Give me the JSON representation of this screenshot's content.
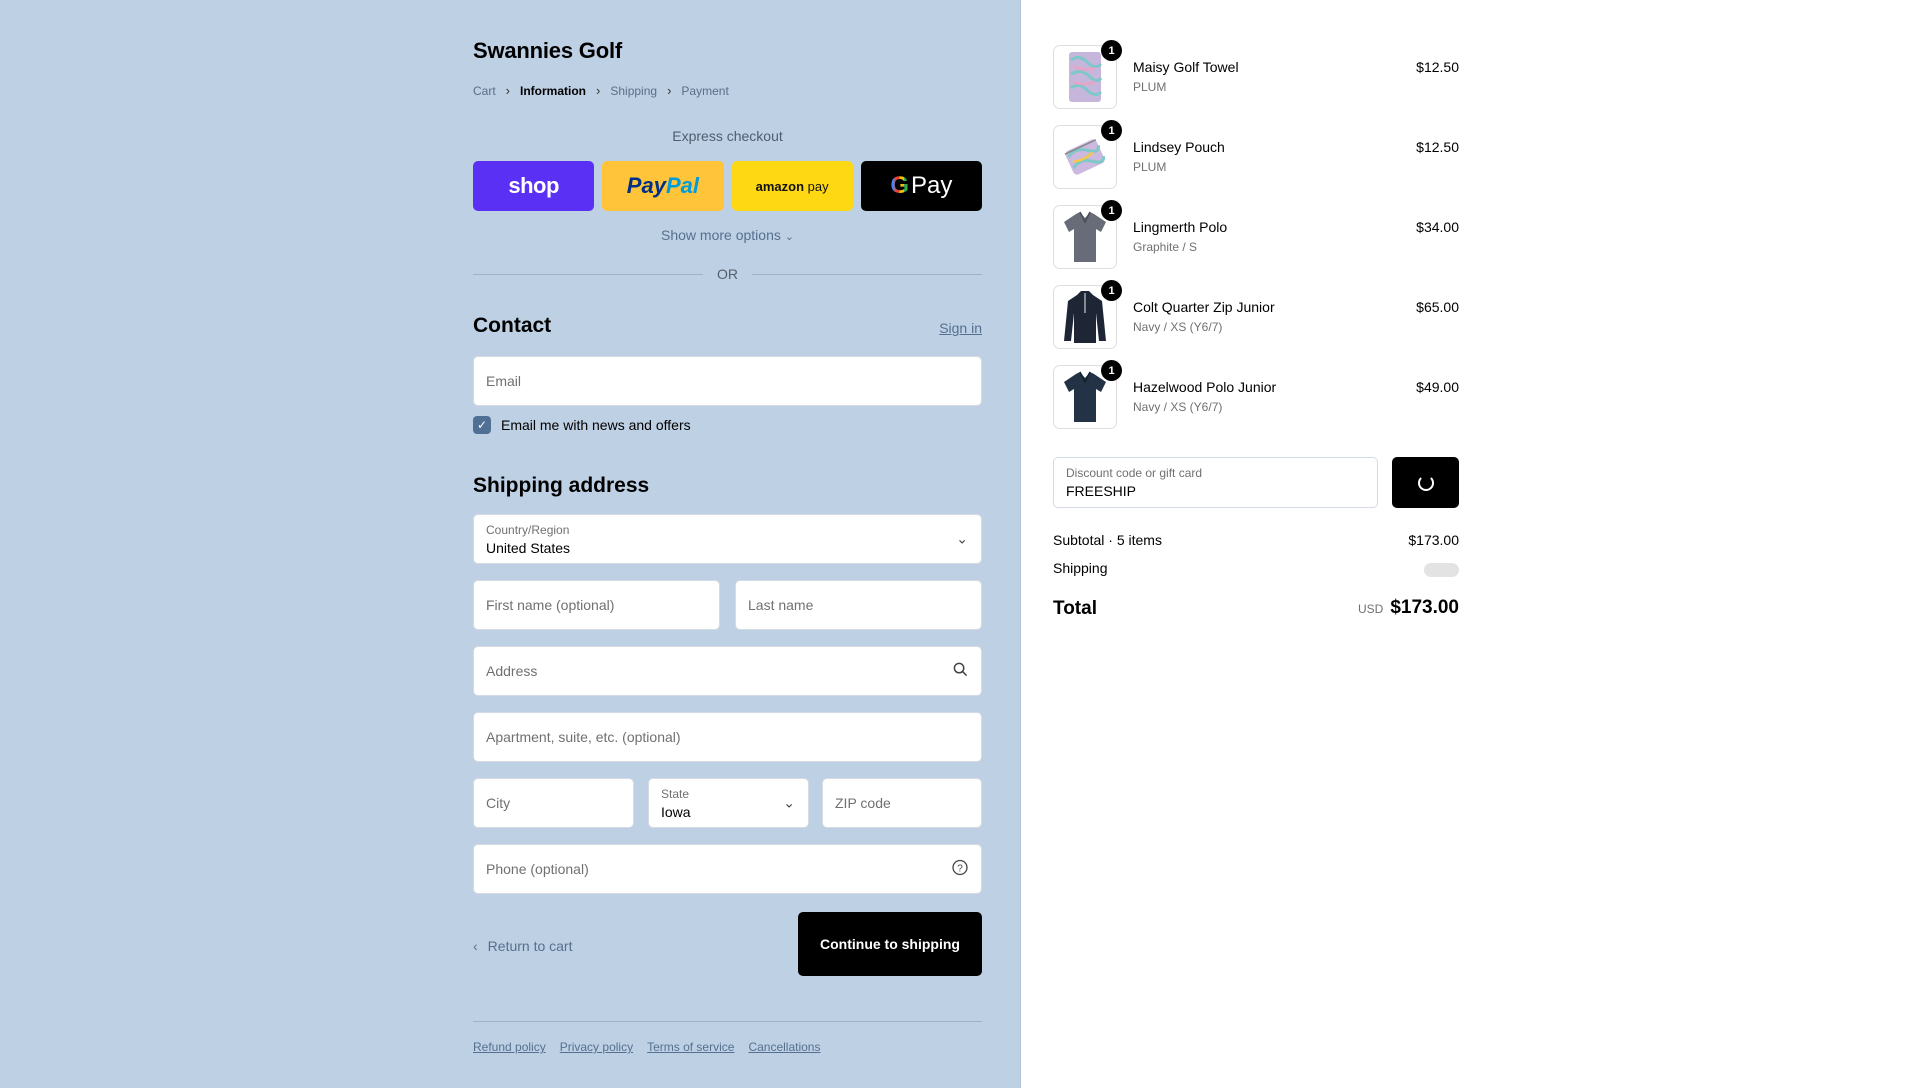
{
  "store": {
    "name": "Swannies Golf"
  },
  "breadcrumbs": [
    {
      "label": "Cart"
    },
    {
      "label": "Information"
    },
    {
      "label": "Shipping"
    },
    {
      "label": "Payment"
    }
  ],
  "express": {
    "title": "Express checkout",
    "shop_label": "shop",
    "paypal_a": "Pay",
    "paypal_b": "Pal",
    "amazon_a": "amazon",
    "amazon_b": "pay",
    "gpay_g": "G",
    "gpay_label": "Pay",
    "more_label": "Show more options"
  },
  "divider_or": "OR",
  "contact": {
    "heading": "Contact",
    "sign_in": "Sign in",
    "email_placeholder": "Email",
    "newsletter_label": "Email me with news and offers",
    "newsletter_checked": true
  },
  "shipping": {
    "heading": "Shipping address",
    "country_label": "Country/Region",
    "country_value": "United States",
    "first_name_placeholder": "First name (optional)",
    "last_name_placeholder": "Last name",
    "address_placeholder": "Address",
    "apartment_placeholder": "Apartment, suite, etc. (optional)",
    "city_placeholder": "City",
    "state_label": "State",
    "state_value": "Iowa",
    "zip_placeholder": "ZIP code",
    "phone_placeholder": "Phone (optional)"
  },
  "actions": {
    "return_label": "Return to cart",
    "continue_label": "Continue to shipping"
  },
  "footer_links": [
    "Refund policy",
    "Privacy policy",
    "Terms of service",
    "Cancellations"
  ],
  "cart_items": [
    {
      "name": "Maisy Golf Towel",
      "variant": "PLUM",
      "price": "$12.50",
      "qty": "1"
    },
    {
      "name": "Lindsey Pouch",
      "variant": "PLUM",
      "price": "$12.50",
      "qty": "1"
    },
    {
      "name": "Lingmerth Polo",
      "variant": "Graphite / S",
      "price": "$34.00",
      "qty": "1"
    },
    {
      "name": "Colt Quarter Zip Junior",
      "variant": "Navy / XS (Y6/7)",
      "price": "$65.00",
      "qty": "1"
    },
    {
      "name": "Hazelwood Polo Junior",
      "variant": "Navy / XS (Y6/7)",
      "price": "$49.00",
      "qty": "1"
    }
  ],
  "discount": {
    "label": "Discount code or gift card",
    "value": "FREESHIP"
  },
  "summary": {
    "subtotal_label": "Subtotal · 5 items",
    "subtotal_value": "$173.00",
    "shipping_label": "Shipping",
    "total_label": "Total",
    "currency": "USD",
    "total_value": "$173.00"
  },
  "colors": {
    "left_bg": "#bed0e4",
    "accent_link": "#55708f",
    "shop_pay": "#5a31f4",
    "paypal": "#ffc439",
    "amazon_pay": "#ffd814",
    "primary_button": "#000000"
  }
}
